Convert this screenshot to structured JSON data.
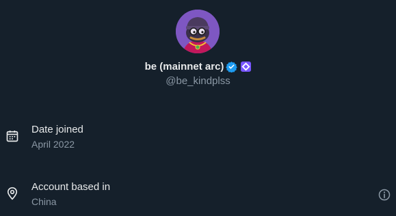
{
  "profile": {
    "display_name": "be (mainnet arc)",
    "handle": "@be_kindplss",
    "avatar_icon": "pepe-avatar",
    "verified_icon": "verified-badge-icon",
    "affiliate_icon": "affiliate-badge-icon"
  },
  "about": {
    "date_joined": {
      "icon": "calendar-icon",
      "label": "Date joined",
      "value": "April 2022"
    },
    "account_based_in": {
      "icon": "location-pin-icon",
      "label": "Account based in",
      "value": "China",
      "info_icon": "info-icon"
    }
  },
  "colors": {
    "background": "#15202b",
    "primary_text": "#e7e9ea",
    "secondary_text": "#8b98a5",
    "verified_blue": "#1d9bf0",
    "affiliate_purple": "#7856ff",
    "avatar_bg": "#7e57c2"
  }
}
